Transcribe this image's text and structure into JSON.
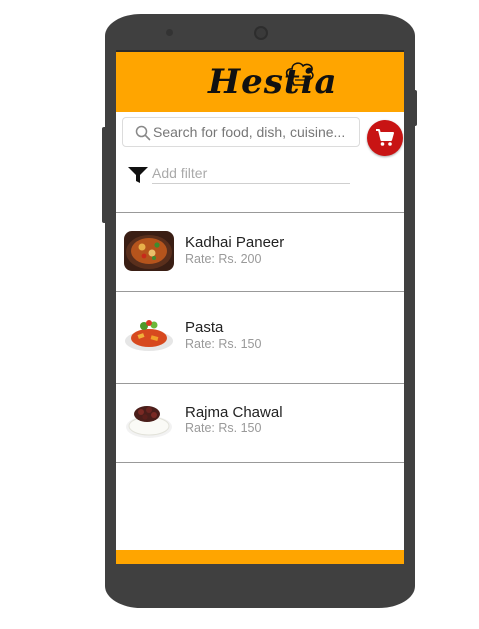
{
  "app": {
    "logo_text": "Hestia"
  },
  "search": {
    "placeholder": "Search for food, dish, cuisine..."
  },
  "filter": {
    "placeholder": "Add filter"
  },
  "colors": {
    "header": "#ffa500",
    "cart_button": "#c81414",
    "footer": "#ffa500"
  },
  "icons": {
    "search": "search-icon",
    "cart": "cart-icon",
    "filter": "filter-icon",
    "logo": "chef-hat-icon"
  },
  "items": [
    {
      "name": "Kadhai Paneer",
      "rate": "Rate: Rs. 200"
    },
    {
      "name": "Pasta",
      "rate": "Rate: Rs. 150"
    },
    {
      "name": "Rajma Chawal",
      "rate": "Rate: Rs. 150"
    }
  ]
}
